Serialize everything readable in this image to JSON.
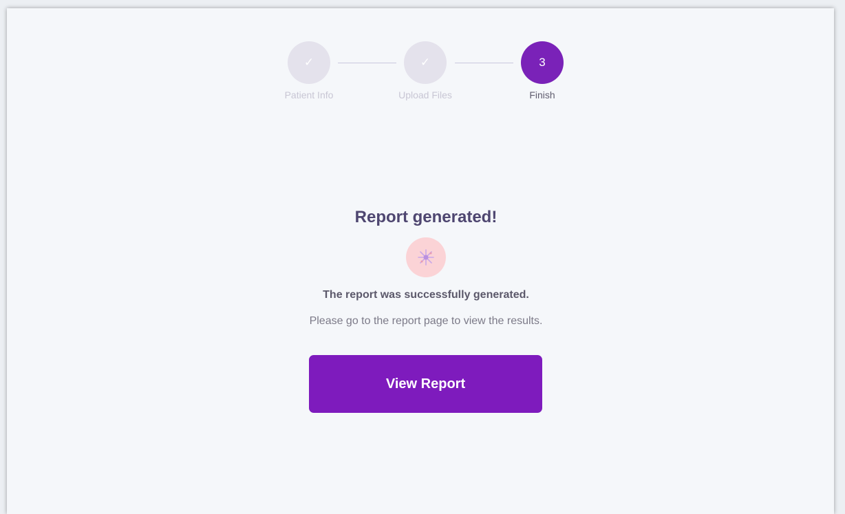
{
  "stepper": {
    "steps": [
      {
        "label": "Patient Info",
        "state": "done",
        "marker": "✓"
      },
      {
        "label": "Upload Files",
        "state": "done",
        "marker": "✓"
      },
      {
        "label": "Finish",
        "state": "active",
        "marker": "3"
      }
    ]
  },
  "result": {
    "title": "Report generated!",
    "icon": "celebration-icon",
    "message": "The report was successfully generated.",
    "hint": "Please go to the report page to view the results."
  },
  "actions": {
    "view_report_label": "View Report"
  },
  "colors": {
    "accent": "#7e1bbd",
    "step_done": "#e4e2ec",
    "icon_bg": "#fbd3d6",
    "background": "#f5f7fa"
  }
}
